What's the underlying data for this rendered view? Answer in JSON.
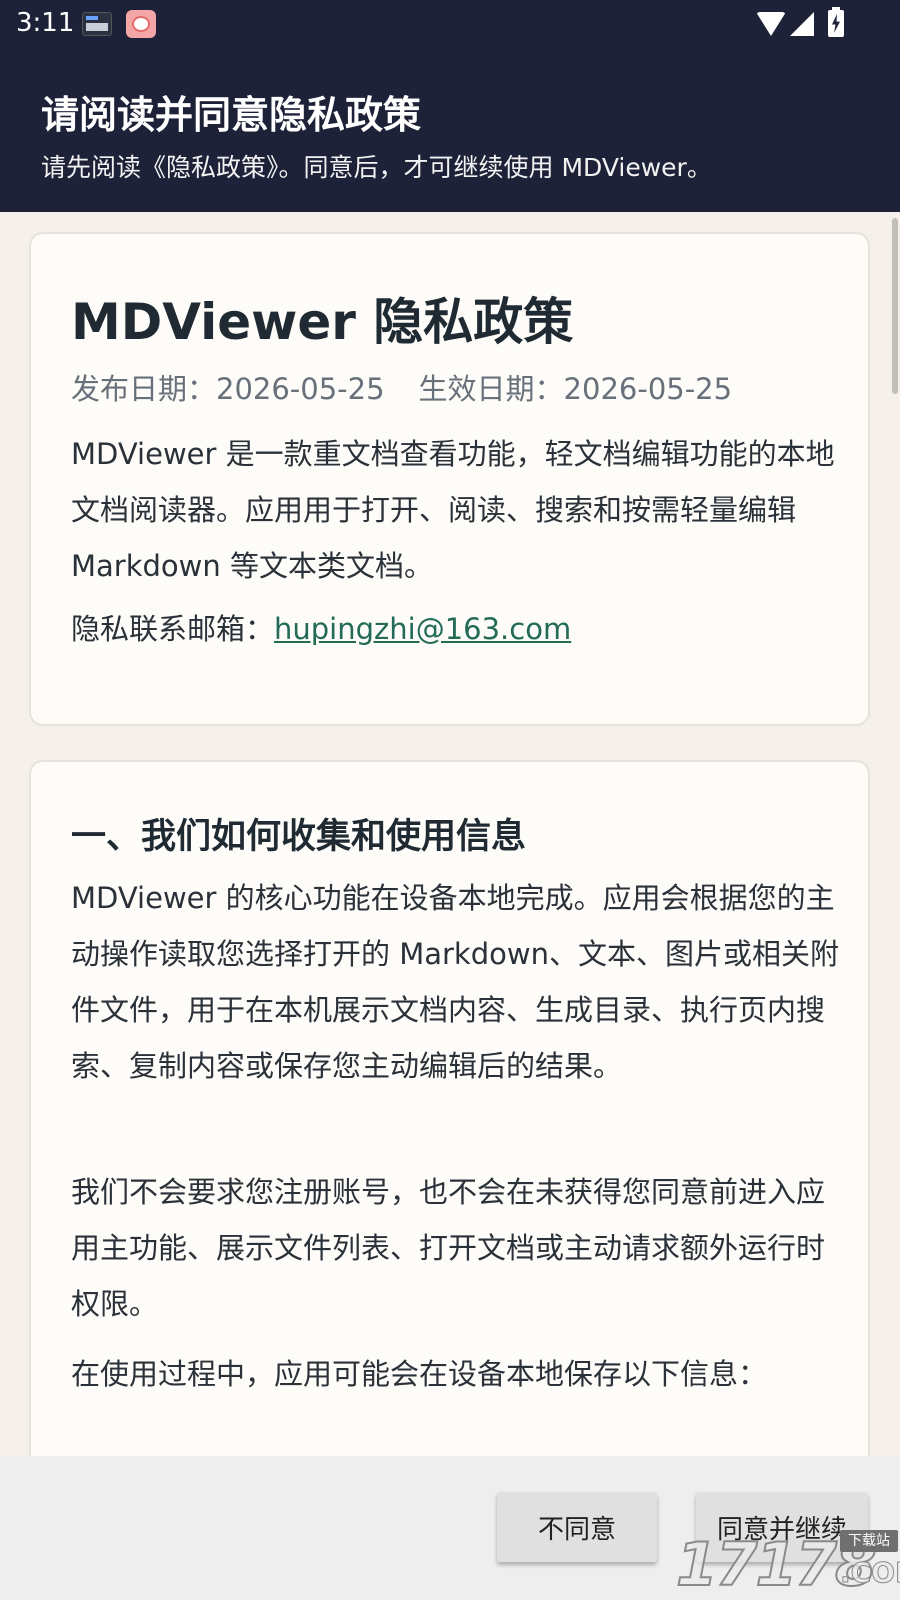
{
  "status_bar": {
    "time": "3:11",
    "icons": [
      "notification-app-icon",
      "notification-app-icon-2",
      "wifi-icon",
      "signal-icon",
      "battery-charging-icon"
    ]
  },
  "header": {
    "title": "请阅读并同意隐私政策",
    "subtitle": "请先阅读《隐私政策》。同意后，才可继续使用 MDViewer。",
    "background_color": "#1e2239"
  },
  "policy": {
    "title": "MDViewer 隐私政策",
    "publish_date": "发布日期：2026-05-25",
    "effective_date": "生效日期：2026-05-25",
    "intro": "MDViewer 是一款重文档查看功能，轻文档编辑功能的本地文档阅读器。应用用于打开、阅读、搜索和按需轻量编辑 Markdown 等文本类文档。",
    "contact_label": "隐私联系邮箱：",
    "contact_email": "hupingzhi@163.com",
    "link_color": "#236b57"
  },
  "section1": {
    "title": "一、我们如何收集和使用信息",
    "paragraphs": [
      "MDViewer 的核心功能在设备本地完成。应用会根据您的主动操作读取您选择打开的 Markdown、文本、图片或相关附件文件，用于在本机展示文档内容、生成目录、执行页内搜索、复制内容或保存您主动编辑后的结果。",
      "我们不会要求您注册账号，也不会在未获得您同意前进入应用主功能、展示文件列表、打开文档或主动请求额外运行时权限。",
      "在使用过程中，应用可能会在设备本地保存以下信息："
    ]
  },
  "actions": {
    "disagree": "不同意",
    "agree": "同意并继续"
  },
  "watermark": {
    "number": "17178",
    "tag": "下载站",
    "suffix": ".COM"
  }
}
